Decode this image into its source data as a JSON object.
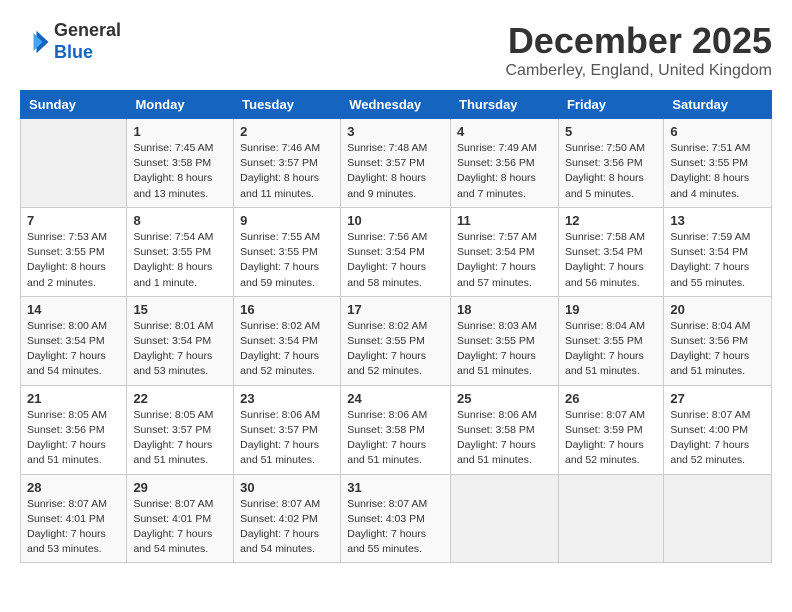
{
  "logo": {
    "general": "General",
    "blue": "Blue"
  },
  "title": "December 2025",
  "location": "Camberley, England, United Kingdom",
  "weekdays": [
    "Sunday",
    "Monday",
    "Tuesday",
    "Wednesday",
    "Thursday",
    "Friday",
    "Saturday"
  ],
  "weeks": [
    [
      {
        "day": "",
        "info": ""
      },
      {
        "day": "1",
        "info": "Sunrise: 7:45 AM\nSunset: 3:58 PM\nDaylight: 8 hours\nand 13 minutes."
      },
      {
        "day": "2",
        "info": "Sunrise: 7:46 AM\nSunset: 3:57 PM\nDaylight: 8 hours\nand 11 minutes."
      },
      {
        "day": "3",
        "info": "Sunrise: 7:48 AM\nSunset: 3:57 PM\nDaylight: 8 hours\nand 9 minutes."
      },
      {
        "day": "4",
        "info": "Sunrise: 7:49 AM\nSunset: 3:56 PM\nDaylight: 8 hours\nand 7 minutes."
      },
      {
        "day": "5",
        "info": "Sunrise: 7:50 AM\nSunset: 3:56 PM\nDaylight: 8 hours\nand 5 minutes."
      },
      {
        "day": "6",
        "info": "Sunrise: 7:51 AM\nSunset: 3:55 PM\nDaylight: 8 hours\nand 4 minutes."
      }
    ],
    [
      {
        "day": "7",
        "info": "Sunrise: 7:53 AM\nSunset: 3:55 PM\nDaylight: 8 hours\nand 2 minutes."
      },
      {
        "day": "8",
        "info": "Sunrise: 7:54 AM\nSunset: 3:55 PM\nDaylight: 8 hours\nand 1 minute."
      },
      {
        "day": "9",
        "info": "Sunrise: 7:55 AM\nSunset: 3:55 PM\nDaylight: 7 hours\nand 59 minutes."
      },
      {
        "day": "10",
        "info": "Sunrise: 7:56 AM\nSunset: 3:54 PM\nDaylight: 7 hours\nand 58 minutes."
      },
      {
        "day": "11",
        "info": "Sunrise: 7:57 AM\nSunset: 3:54 PM\nDaylight: 7 hours\nand 57 minutes."
      },
      {
        "day": "12",
        "info": "Sunrise: 7:58 AM\nSunset: 3:54 PM\nDaylight: 7 hours\nand 56 minutes."
      },
      {
        "day": "13",
        "info": "Sunrise: 7:59 AM\nSunset: 3:54 PM\nDaylight: 7 hours\nand 55 minutes."
      }
    ],
    [
      {
        "day": "14",
        "info": "Sunrise: 8:00 AM\nSunset: 3:54 PM\nDaylight: 7 hours\nand 54 minutes."
      },
      {
        "day": "15",
        "info": "Sunrise: 8:01 AM\nSunset: 3:54 PM\nDaylight: 7 hours\nand 53 minutes."
      },
      {
        "day": "16",
        "info": "Sunrise: 8:02 AM\nSunset: 3:54 PM\nDaylight: 7 hours\nand 52 minutes."
      },
      {
        "day": "17",
        "info": "Sunrise: 8:02 AM\nSunset: 3:55 PM\nDaylight: 7 hours\nand 52 minutes."
      },
      {
        "day": "18",
        "info": "Sunrise: 8:03 AM\nSunset: 3:55 PM\nDaylight: 7 hours\nand 51 minutes."
      },
      {
        "day": "19",
        "info": "Sunrise: 8:04 AM\nSunset: 3:55 PM\nDaylight: 7 hours\nand 51 minutes."
      },
      {
        "day": "20",
        "info": "Sunrise: 8:04 AM\nSunset: 3:56 PM\nDaylight: 7 hours\nand 51 minutes."
      }
    ],
    [
      {
        "day": "21",
        "info": "Sunrise: 8:05 AM\nSunset: 3:56 PM\nDaylight: 7 hours\nand 51 minutes."
      },
      {
        "day": "22",
        "info": "Sunrise: 8:05 AM\nSunset: 3:57 PM\nDaylight: 7 hours\nand 51 minutes."
      },
      {
        "day": "23",
        "info": "Sunrise: 8:06 AM\nSunset: 3:57 PM\nDaylight: 7 hours\nand 51 minutes."
      },
      {
        "day": "24",
        "info": "Sunrise: 8:06 AM\nSunset: 3:58 PM\nDaylight: 7 hours\nand 51 minutes."
      },
      {
        "day": "25",
        "info": "Sunrise: 8:06 AM\nSunset: 3:58 PM\nDaylight: 7 hours\nand 51 minutes."
      },
      {
        "day": "26",
        "info": "Sunrise: 8:07 AM\nSunset: 3:59 PM\nDaylight: 7 hours\nand 52 minutes."
      },
      {
        "day": "27",
        "info": "Sunrise: 8:07 AM\nSunset: 4:00 PM\nDaylight: 7 hours\nand 52 minutes."
      }
    ],
    [
      {
        "day": "28",
        "info": "Sunrise: 8:07 AM\nSunset: 4:01 PM\nDaylight: 7 hours\nand 53 minutes."
      },
      {
        "day": "29",
        "info": "Sunrise: 8:07 AM\nSunset: 4:01 PM\nDaylight: 7 hours\nand 54 minutes."
      },
      {
        "day": "30",
        "info": "Sunrise: 8:07 AM\nSunset: 4:02 PM\nDaylight: 7 hours\nand 54 minutes."
      },
      {
        "day": "31",
        "info": "Sunrise: 8:07 AM\nSunset: 4:03 PM\nDaylight: 7 hours\nand 55 minutes."
      },
      {
        "day": "",
        "info": ""
      },
      {
        "day": "",
        "info": ""
      },
      {
        "day": "",
        "info": ""
      }
    ]
  ]
}
